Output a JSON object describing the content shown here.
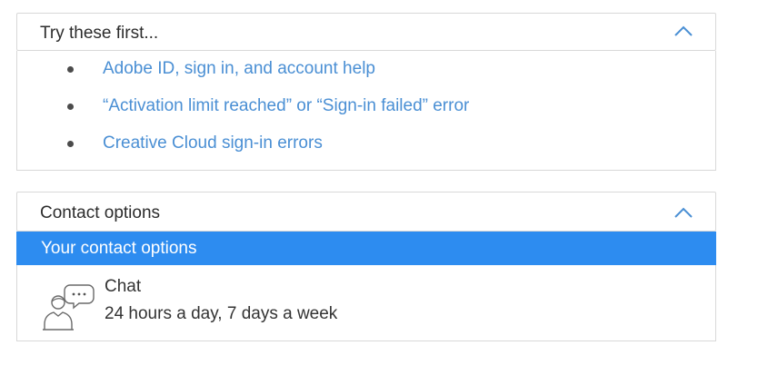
{
  "try_first": {
    "title": "Try these first...",
    "links": [
      {
        "label": "Adobe ID, sign in, and account help"
      },
      {
        "label": "“Activation limit reached” or “Sign-in failed” error"
      },
      {
        "label": "Creative Cloud sign-in errors"
      }
    ]
  },
  "contact": {
    "title": "Contact options",
    "subheader": "Your contact options",
    "chat": {
      "label": "Chat",
      "availability": "24 hours a day, 7 days a week",
      "icon": "chat-person-icon"
    }
  },
  "colors": {
    "link": "#4a8fd4",
    "accent": "#2d8cf0",
    "border": "#d8d8d8"
  }
}
